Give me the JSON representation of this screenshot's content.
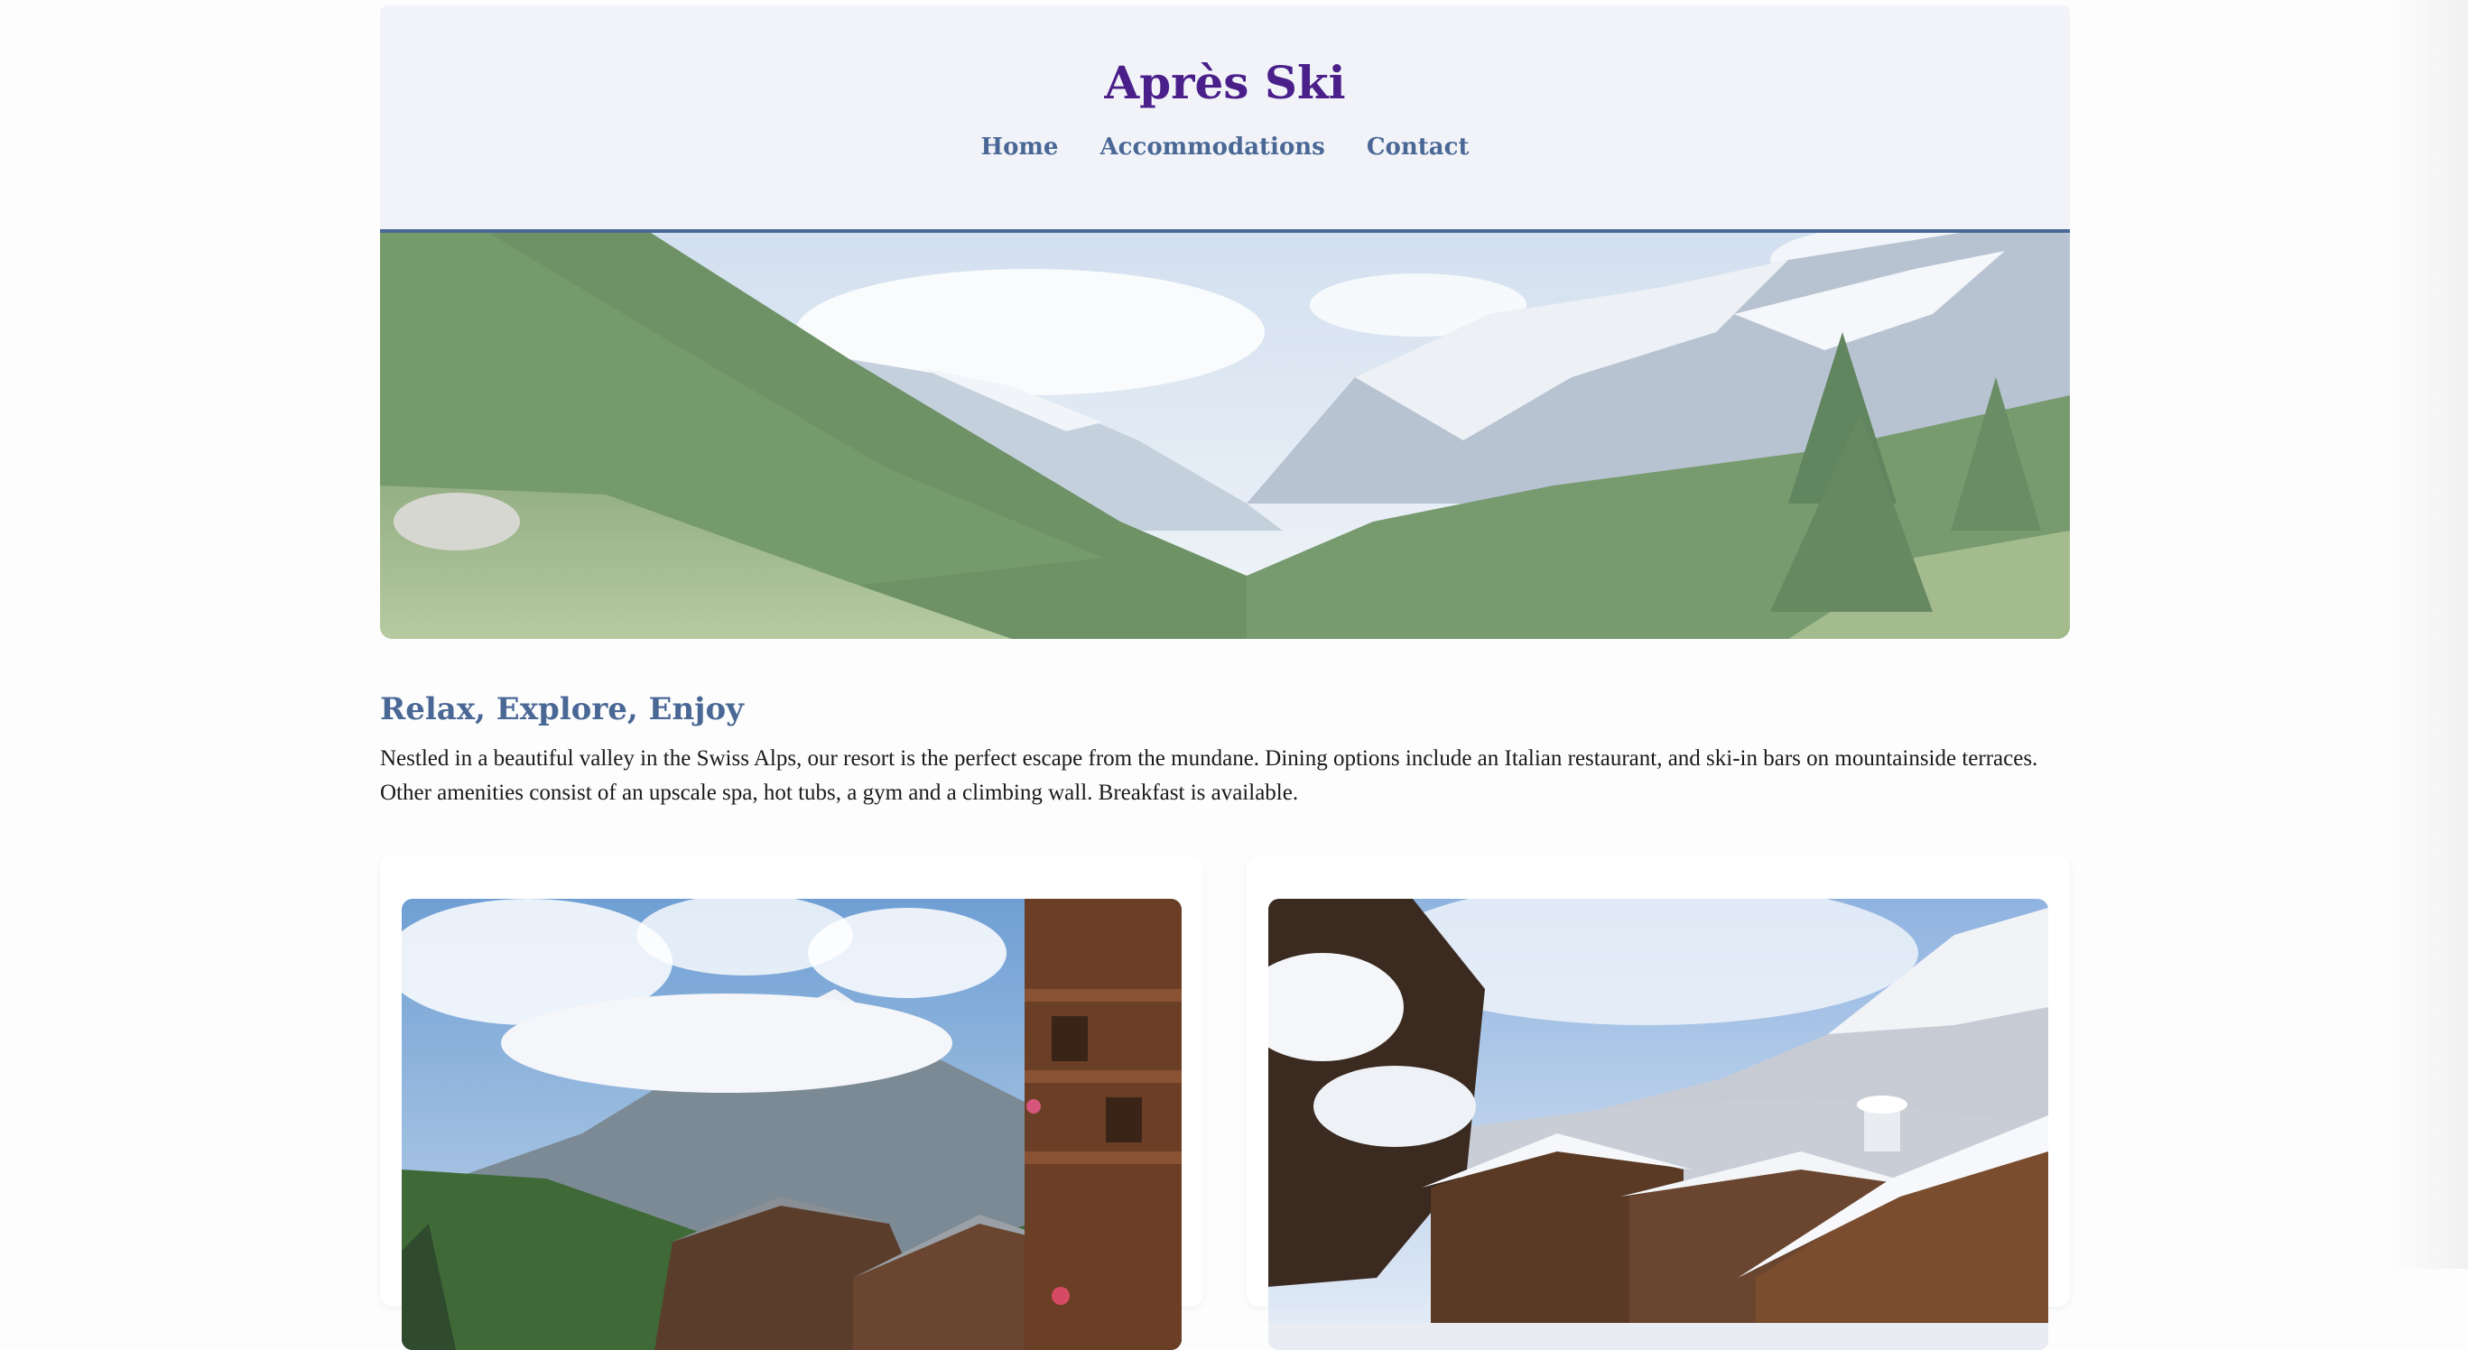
{
  "site": {
    "title": "Après Ski"
  },
  "nav": {
    "items": [
      {
        "label": "Home"
      },
      {
        "label": "Accommodations"
      },
      {
        "label": "Contact"
      }
    ]
  },
  "hero": {
    "image": "alpine-valley-photo"
  },
  "intro": {
    "heading": "Relax, Explore, Enjoy",
    "body": "Nestled in a beautiful valley in the Swiss Alps, our resort is the perfect escape from the mundane. Dining options include an Italian restaurant, and ski-in bars on mountainside terraces. Other amenities consist of an upscale spa, hot tubs, a gym and a climbing wall. Breakfast is available."
  },
  "cards": [
    {
      "image": "summer-chalet-village-photo"
    },
    {
      "image": "winter-snowy-village-photo"
    }
  ],
  "colors": {
    "title": "#4a1f8a",
    "nav": "#4a6896",
    "header_bg": "#f1f3f8",
    "header_border": "#4a6896",
    "heading": "#4a6896"
  }
}
